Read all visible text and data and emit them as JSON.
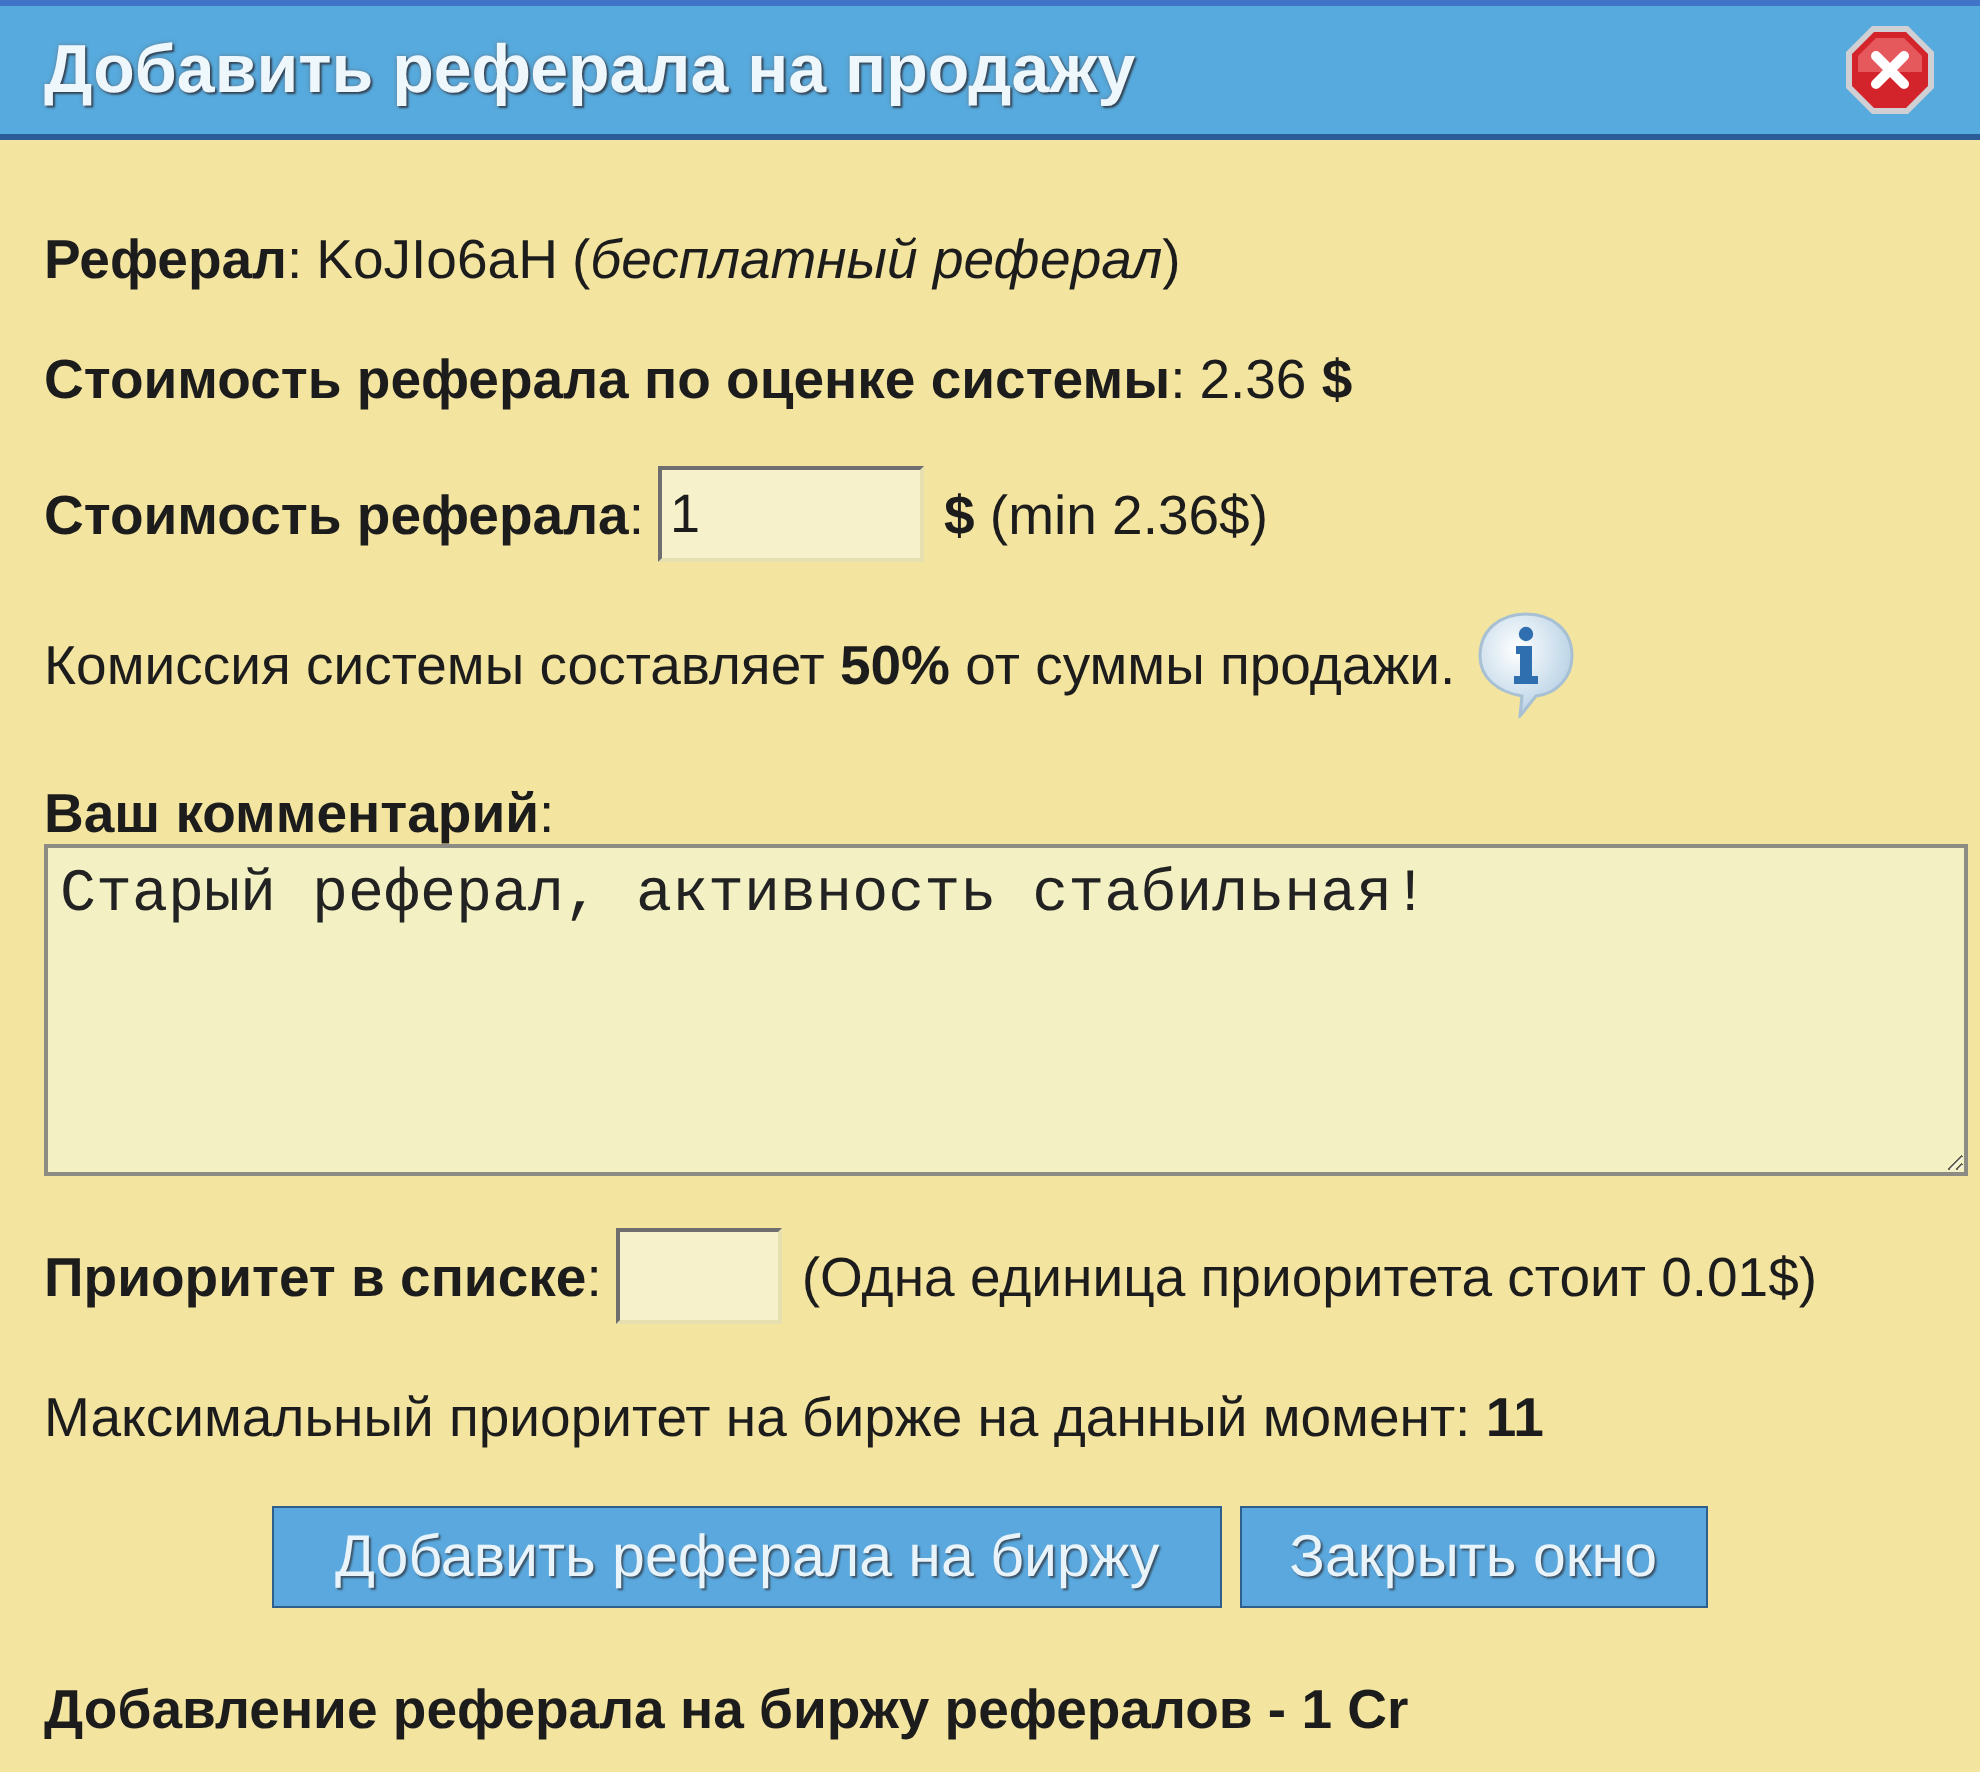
{
  "window": {
    "title": "Добавить реферала на продажу"
  },
  "referral": {
    "label": "**Реферал**:",
    "name": "KoJIo6aH",
    "note": "(*бесплатный реферал*)"
  },
  "estimated_cost": {
    "label": "**Стоимость реферала по оценке системы**:",
    "value": "2.36 **$**"
  },
  "price": {
    "label": "**Стоимость реферала**:",
    "value": "1",
    "hint": "**$** (min 2.36$)"
  },
  "commission": {
    "text": "Комиссия системы составляет **50%** от суммы продажи."
  },
  "comment": {
    "label": "**Ваш комментарий**:",
    "value": "Старый реферал, активность стабильная!"
  },
  "priority": {
    "label": "**Приоритет в списке**:",
    "hint": "(Одна единица приоритета стоит 0.01$)"
  },
  "max_priority": {
    "text": "Максимальный приоритет на бирже на данный момент: **11**"
  },
  "buttons": [
    "Добавить реферала на биржу",
    "Закрыть окно"
  ],
  "footer": {
    "text": "Добавление реферала на биржу рефералов - 1 Cr"
  }
}
